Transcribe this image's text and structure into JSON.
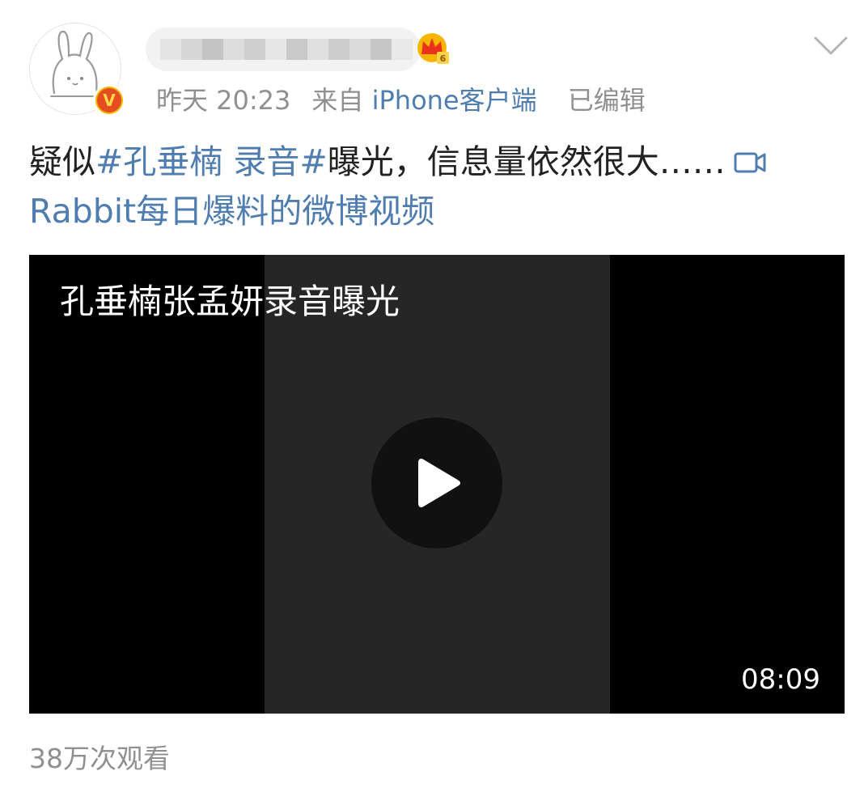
{
  "post": {
    "time": "昨天 20:23",
    "source_prefix": "来自",
    "source": "iPhone客户端",
    "edited": "已编辑",
    "text_prefix": "疑似",
    "hashtag": "#孔垂楠 录音#",
    "text_suffix": "曝光，信息量依然很大……",
    "video_link": "Rabbit每日爆料的微博视频"
  },
  "video": {
    "title": "孔垂楠张孟妍录音曝光",
    "duration": "08:09"
  },
  "views": "38万次观看",
  "icons": {
    "avatar": "bunny-avatar-icon",
    "badge": "verified-v-icon",
    "vip": "vip-crown-icon",
    "menu": "chevron-down-icon",
    "video_link": "video-camera-icon",
    "play": "play-icon"
  },
  "colors": {
    "link": "#507daf",
    "meta": "#909090",
    "text": "#222222",
    "badge": "#f7b500"
  }
}
